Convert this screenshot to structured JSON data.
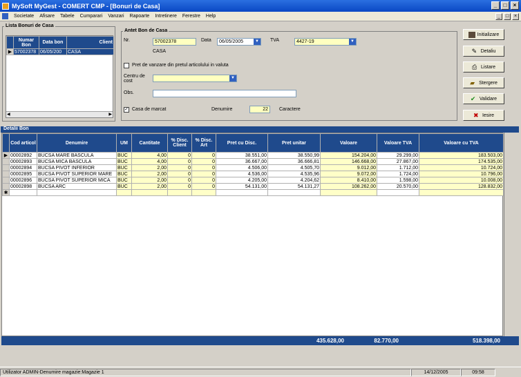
{
  "window": {
    "title": "MySoft MyGest  -  COMERT CMP - [Bonuri de Casa]"
  },
  "menu": [
    "Societate",
    "Afisare",
    "Tabele",
    "Cumparari",
    "Vanzari",
    "Rapoarte",
    "Intretinere",
    "Ferestre",
    "Help"
  ],
  "list_panel": {
    "title": "Lista Bonuri de Casa",
    "columns": [
      "Numar Bon",
      "Data bon",
      "Client"
    ],
    "rows": [
      {
        "nr": "57002378",
        "data": "06/05/200",
        "client": "CASA"
      }
    ]
  },
  "antet": {
    "title": "Antet Bon de Casa",
    "nr_label": "Nr.",
    "nr_value": "57002378",
    "data_label": "Data",
    "data_value": "06/05/2005",
    "tva_label": "TVA",
    "tva_value": "4427-19",
    "client_value": "CASA",
    "pret_valuta_label": "Pret de vanzare din pretul articolului in valuta",
    "centru_label": "Centru de cost",
    "obs_label": "Obs.",
    "casa_marcat_label": "Casa de marcat",
    "denumire_label": "Denumire",
    "denumire_value": "22",
    "caractere_label": "Caractere"
  },
  "buttons": {
    "initializare": "Initializare",
    "detaliu": "Detaliu",
    "listare": "Listare",
    "stergere": "Stergere",
    "validare": "Validare",
    "iesire": "Iesire"
  },
  "detalii": {
    "title": "Detalii Bon",
    "columns": [
      "Cod articol",
      "Denumire",
      "UM",
      "Cantitate",
      "% Disc. Client",
      "% Disc. Art",
      "Pret cu Disc.",
      "Pret unitar",
      "Valoare",
      "Valoare TVA",
      "Valoare cu TVA"
    ],
    "rows": [
      [
        "00002892",
        "BUCSA MARE BASCULA",
        "BUC",
        "4,00",
        "0",
        "0",
        "38.551,00",
        "38.550,99",
        "154.204,00",
        "29.299,00",
        "183.503,00"
      ],
      [
        "00002893",
        "BUCSA MICA BASCULA",
        "BUC",
        "4,00",
        "0",
        "0",
        "36.667,00",
        "36.666,81",
        "146.668,00",
        "27.867,00",
        "174.535,00"
      ],
      [
        "00002894",
        "BUCSA PIVOT INFERIOR",
        "BUC",
        "2,00",
        "0",
        "0",
        "4.506,00",
        "4.505,70",
        "9.012,00",
        "1.712,00",
        "10.724,00"
      ],
      [
        "00002895",
        "BUCSA PIVOT SUPERIOR MARE",
        "BUC",
        "2,00",
        "0",
        "0",
        "4.536,00",
        "4.535,96",
        "9.072,00",
        "1.724,00",
        "10.796,00"
      ],
      [
        "00002896",
        "BUCSA PIVOT SUPERIOR MICA",
        "BUC",
        "2,00",
        "0",
        "0",
        "4.205,00",
        "4.204,62",
        "8.410,00",
        "1.598,00",
        "10.008,00"
      ],
      [
        "00002898",
        "BUCSA ARC",
        "BUC",
        "2,00",
        "0",
        "0",
        "54.131,00",
        "54.131,27",
        "108.262,00",
        "20.570,00",
        "128.832,00"
      ]
    ],
    "totals": {
      "valoare": "435.628,00",
      "valoare_tva": "82.770,00",
      "valoare_cu_tva": "518.398,00"
    }
  },
  "status": {
    "user": "Utilizator ADMIN-Denumire magazie:Magazie 1",
    "date": "14/12/2005",
    "time": "09:58"
  }
}
